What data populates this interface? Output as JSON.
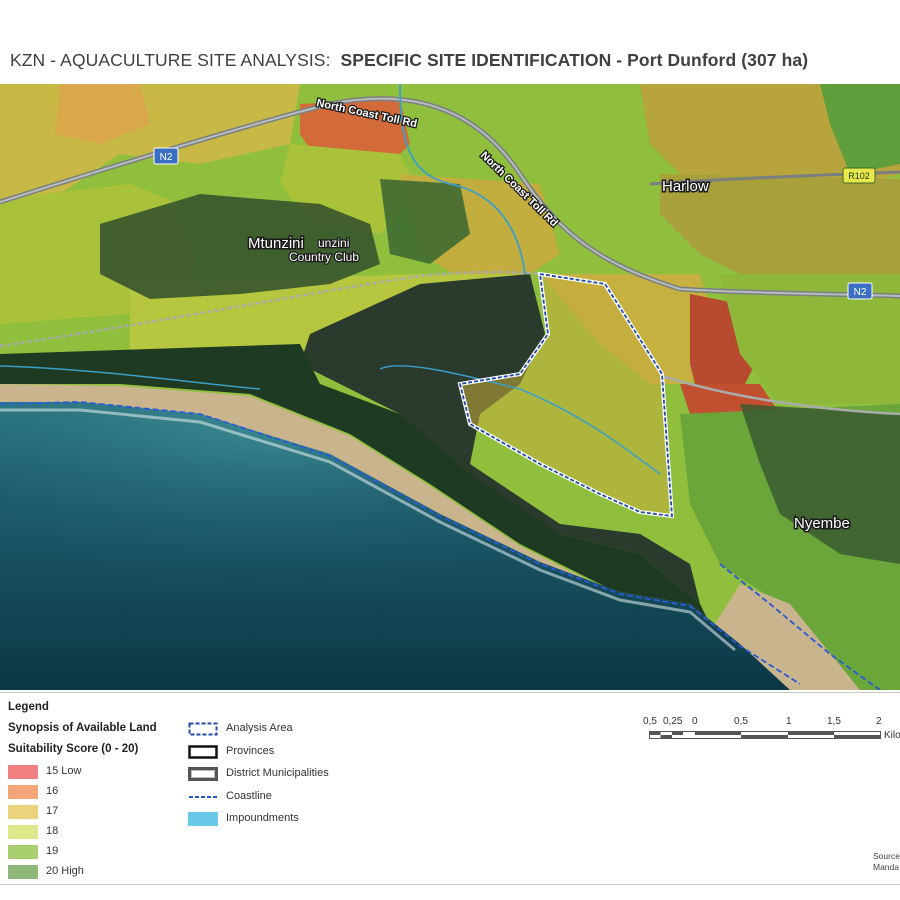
{
  "title": {
    "prefix": "KZN - AQUACULTURE SITE ANALYSIS:",
    "main": "SPECIFIC SITE IDENTIFICATION - Port Dunford (307 ha)"
  },
  "map": {
    "labels": {
      "toll_road_1": "North Coast Toll Rd",
      "toll_road_2": "North Coast Toll Rd",
      "n2_west": "N2",
      "n2_east": "N2",
      "r102": "R102",
      "mtunzini": "Mtunzini",
      "country_club_1": "unzini",
      "country_club_2": "Country Club",
      "harlow": "Harlow",
      "nyembe": "Nyembe"
    },
    "colors": {
      "ocean_deep": "#0e4350",
      "ocean_shallow": "#2f7b88",
      "beach": "#c9b48e",
      "score_15": "#d9534f",
      "score_16": "#e8925e",
      "score_17": "#d9b24c",
      "score_18": "#b9c73c",
      "score_19": "#8fbf3c",
      "score_20": "#5f9e3a",
      "analysis_area": "#1f4aa8",
      "coastline": "#2a5bd7",
      "impoundments": "#6cc8e8"
    }
  },
  "legend": {
    "heading": "Legend",
    "synopsis_title": "Synopsis of Available Land",
    "score_title": "Suitability Score (0 - 20)",
    "scores": [
      {
        "label": "15  Low",
        "color": "#f08080"
      },
      {
        "label": "16",
        "color": "#f4a57a"
      },
      {
        "label": "17",
        "color": "#ecd27a"
      },
      {
        "label": "18",
        "color": "#dde88a"
      },
      {
        "label": "19",
        "color": "#a9cf6f"
      },
      {
        "label": "20  High",
        "color": "#8db87a"
      }
    ],
    "symbols": {
      "analysis_area": "Analysis Area",
      "provinces": "Provinces",
      "district_municipalities": "District Municipalities",
      "coastline": "Coastline",
      "impoundments": "Impoundments"
    }
  },
  "scalebar": {
    "ticks": [
      "0,5",
      "0,25",
      "0",
      "0,5",
      "1",
      "1,5",
      "2"
    ],
    "unit": "Kilo"
  },
  "source": {
    "line1": "Source",
    "line2": "Manda"
  }
}
